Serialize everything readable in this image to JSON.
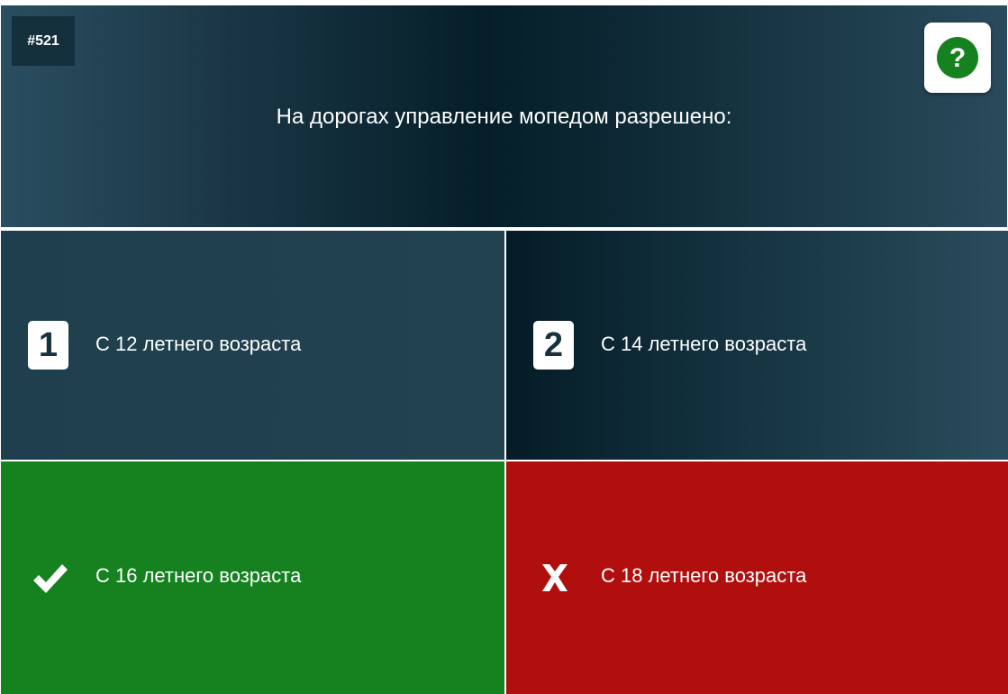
{
  "question": {
    "number": "#521",
    "text": "На дорогах управление мопедом разрешено:",
    "help_icon": "question-mark-icon",
    "help_color": "#15821f"
  },
  "answers": [
    {
      "badge": "1",
      "text": "С 12 летнего возраста",
      "state": "neutral"
    },
    {
      "badge": "2",
      "text": "С 14 летнего возраста",
      "state": "neutral"
    },
    {
      "badge": "",
      "text": "С 16 летнего возраста",
      "state": "correct",
      "icon": "checkmark-icon",
      "color": "#15821f"
    },
    {
      "badge": "",
      "text": "С 18 летнего возраста",
      "state": "wrong",
      "icon": "cross-icon",
      "color": "#b10f0e"
    }
  ]
}
